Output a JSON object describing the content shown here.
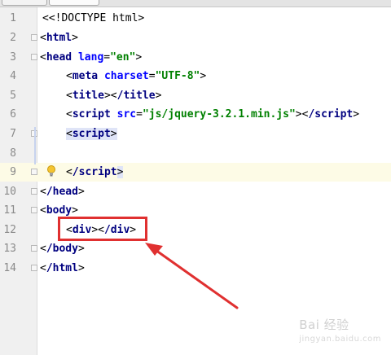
{
  "editor": {
    "lines": [
      {
        "n": "1"
      },
      {
        "n": "2"
      },
      {
        "n": "3"
      },
      {
        "n": "4"
      },
      {
        "n": "5"
      },
      {
        "n": "6"
      },
      {
        "n": "7"
      },
      {
        "n": "8"
      },
      {
        "n": "9"
      },
      {
        "n": "10"
      },
      {
        "n": "11"
      },
      {
        "n": "12"
      },
      {
        "n": "13"
      },
      {
        "n": "14"
      }
    ],
    "code": {
      "l1": "<!DOCTYPE html>",
      "l2_tag": "html",
      "l3_tag": "head",
      "l3_attr": "lang",
      "l3_val": "\"en\"",
      "l4_tag": "meta",
      "l4_attr": "charset",
      "l4_val": "\"UTF-8\"",
      "l5_open": "title",
      "l5_close": "/title",
      "l6_tag": "script",
      "l6_attr": "src",
      "l6_val": "\"js/jquery-3.2.1.min.js\"",
      "l6_close": "/script",
      "l7_tag": "script",
      "l9_close": "/script",
      "l10_close": "/head",
      "l11_tag": "body",
      "l12_open": "div",
      "l12_close": "/div",
      "l13_close": "/body",
      "l14_close": "/html"
    },
    "current_line": 9
  },
  "annotation": {
    "highlight_color": "#e03030",
    "target": "<div></div>"
  },
  "watermark": {
    "text": "Bai 经验",
    "sub": "jingyan.baidu.com"
  },
  "colors": {
    "tag": "#000080",
    "attribute": "#0000ff",
    "value": "#008000",
    "line_number": "#8a8a8a"
  }
}
